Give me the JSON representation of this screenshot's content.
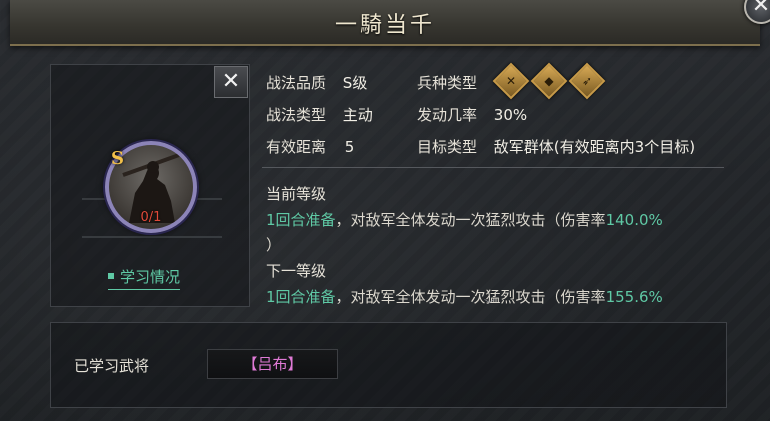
{
  "dialog": {
    "title": "一騎当千"
  },
  "tactic": {
    "grade_badge": "S",
    "level_count": "0/1",
    "learn_status": "学习情况",
    "attributes": {
      "quality_label": "战法品质",
      "quality_value": "S级",
      "troop_label": "兵种类型",
      "type_label": "战法类型",
      "type_value": "主动",
      "rate_label": "发动几率",
      "rate_value": "30%",
      "range_label": "有效距离",
      "range_value": "5",
      "target_label": "目标类型",
      "target_value": "敌军群体(有效距离内3个目标)"
    },
    "troop_icons": [
      "cavalry-icon",
      "shield-icon",
      "archer-icon"
    ],
    "current_level": {
      "heading": "当前等级",
      "prep": "1回合准备",
      "effect": "，对敌军全体发动一次猛烈攻击（伤害率",
      "rate": "140.0%",
      "close": "）"
    },
    "next_level": {
      "heading": "下一等级",
      "prep": "1回合准备",
      "effect": "，对敌军全体发动一次猛烈攻击（伤害率",
      "rate": "155.6%"
    }
  },
  "learned": {
    "label": "已学习武将",
    "general": "【吕布】"
  },
  "colors": {
    "highlight_green": "#5fc9a5",
    "general_pink": "#e07ad6",
    "gold": "#d7a955"
  }
}
